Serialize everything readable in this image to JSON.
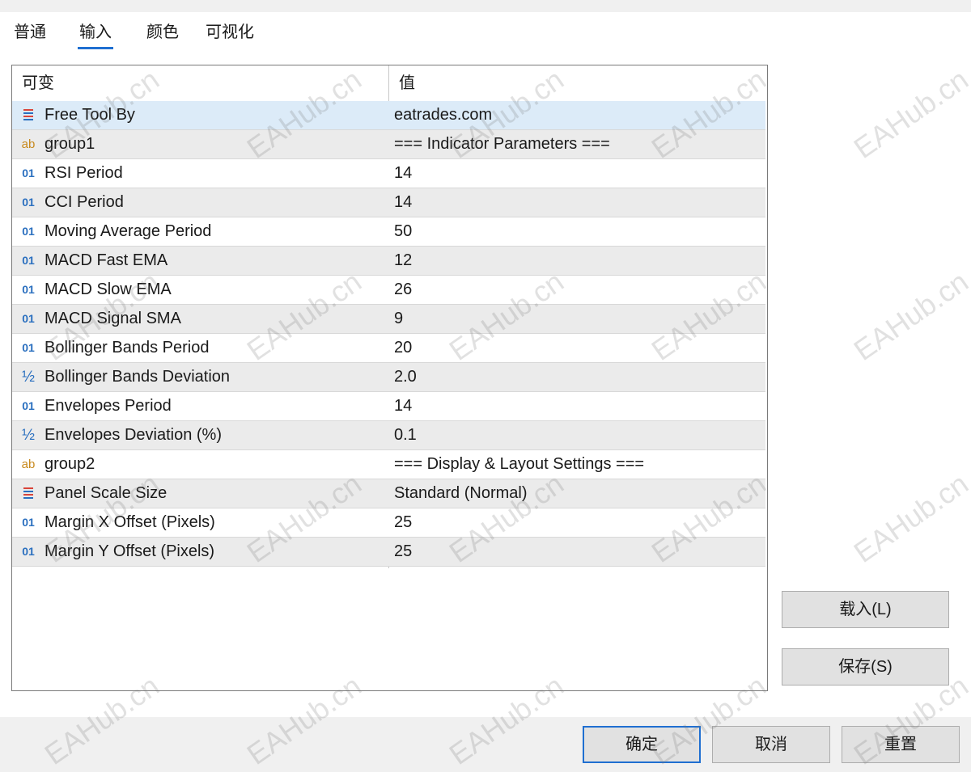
{
  "tabs": [
    {
      "label": "普通"
    },
    {
      "label": "输入"
    },
    {
      "label": "颜色"
    },
    {
      "label": "可视化"
    }
  ],
  "grid": {
    "header_name": "可变",
    "header_value": "值",
    "rows": [
      {
        "type": "enum",
        "name": "Free Tool By",
        "value": "eatrades.com"
      },
      {
        "type": "string",
        "icon_text": "ab",
        "name": "group1",
        "value": "=== Indicator Parameters ==="
      },
      {
        "type": "int",
        "icon_text": "01",
        "name": "RSI Period",
        "value": "14"
      },
      {
        "type": "int",
        "icon_text": "01",
        "name": "CCI Period",
        "value": "14"
      },
      {
        "type": "int",
        "icon_text": "01",
        "name": "Moving Average Period",
        "value": "50"
      },
      {
        "type": "int",
        "icon_text": "01",
        "name": "MACD Fast EMA",
        "value": "12"
      },
      {
        "type": "int",
        "icon_text": "01",
        "name": "MACD Slow EMA",
        "value": "26"
      },
      {
        "type": "int",
        "icon_text": "01",
        "name": "MACD Signal SMA",
        "value": "9"
      },
      {
        "type": "int",
        "icon_text": "01",
        "name": "Bollinger Bands Period",
        "value": "20"
      },
      {
        "type": "double",
        "icon_text": "½",
        "name": "Bollinger Bands Deviation",
        "value": "2.0"
      },
      {
        "type": "int",
        "icon_text": "01",
        "name": "Envelopes Period",
        "value": "14"
      },
      {
        "type": "double",
        "icon_text": "½",
        "name": "Envelopes Deviation (%)",
        "value": "0.1"
      },
      {
        "type": "string",
        "icon_text": "ab",
        "name": "group2",
        "value": "=== Display & Layout Settings ==="
      },
      {
        "type": "enum",
        "name": "Panel Scale Size",
        "value": "Standard (Normal)"
      },
      {
        "type": "int",
        "icon_text": "01",
        "name": "Margin X Offset (Pixels)",
        "value": "25"
      },
      {
        "type": "int",
        "icon_text": "01",
        "name": "Margin Y Offset (Pixels)",
        "value": "25"
      }
    ]
  },
  "side_buttons": {
    "load": "载入(L)",
    "save": "保存(S)"
  },
  "footer_buttons": {
    "ok": "确定",
    "cancel": "取消",
    "reset": "重置"
  },
  "watermark": "EAHub.cn",
  "colors": {
    "accent": "#1f6fd1",
    "selected_row": "#dcebf8",
    "alt_row": "#ebebeb",
    "int_icon": "#2a6fbf",
    "string_icon": "#c88a1e",
    "enum_icon_red": "#d9443a",
    "enum_icon_blue": "#2a6fbf"
  }
}
